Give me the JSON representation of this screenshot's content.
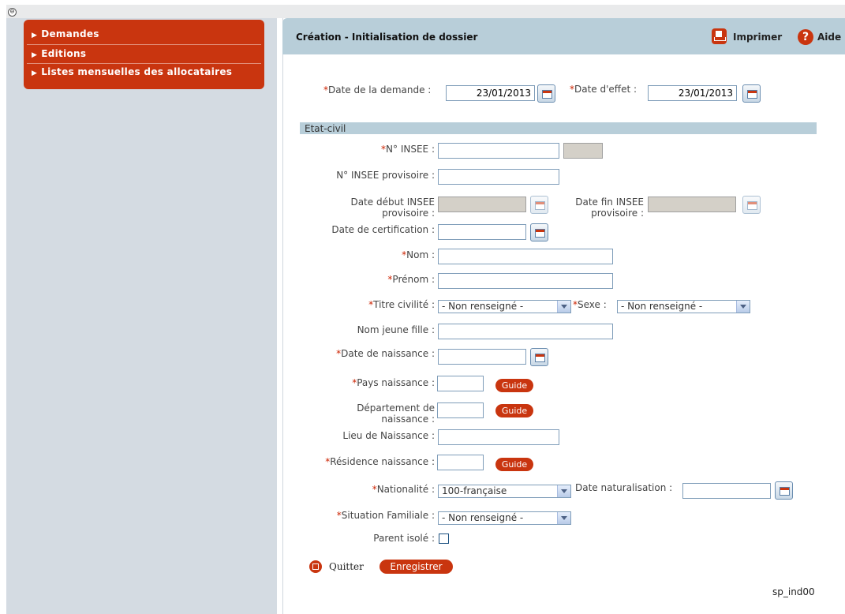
{
  "collapse_icon": "⊖",
  "menu": {
    "items": [
      {
        "label": "Demandes"
      },
      {
        "label": "Editions"
      },
      {
        "label": "Listes mensuelles des allocataires"
      }
    ]
  },
  "header": {
    "title": "Création - Initialisation de dossier",
    "print_label": "Imprimer",
    "help_label": "Aide",
    "help_glyph": "?"
  },
  "required_mark": "*",
  "form": {
    "date_demande": {
      "label": "Date de la demande :",
      "value": "23/01/2013"
    },
    "date_effet": {
      "label": "Date d'effet :",
      "value": "23/01/2013"
    },
    "section_title": "Etat-civil",
    "no_insee": {
      "label": "N° INSEE :",
      "value": ""
    },
    "no_insee_prov": {
      "label": "N° INSEE provisoire :",
      "value": ""
    },
    "date_debut_insee": {
      "label_line1": "Date début INSEE",
      "label_line2": "provisoire :",
      "value": ""
    },
    "date_fin_insee": {
      "label_line1": "Date fin INSEE",
      "label_line2": "provisoire :",
      "value": ""
    },
    "date_certification": {
      "label": "Date de certification :",
      "value": ""
    },
    "nom": {
      "label": "Nom :",
      "value": ""
    },
    "prenom": {
      "label": "Prénom :",
      "value": ""
    },
    "titre_civilite": {
      "label": "Titre civilité :",
      "value": "- Non renseigné -"
    },
    "sexe": {
      "label": "Sexe :",
      "value": "- Non renseigné -"
    },
    "nom_jeune_fille": {
      "label": "Nom jeune fille :",
      "value": ""
    },
    "date_naissance": {
      "label": "Date de naissance :",
      "value": ""
    },
    "pays_naissance": {
      "label": "Pays naissance :",
      "value": "",
      "guide": "Guide"
    },
    "departement_naissance": {
      "label_line1": "Département de",
      "label_line2": "naissance :",
      "value": "",
      "guide": "Guide"
    },
    "lieu_naissance": {
      "label": "Lieu de Naissance :",
      "value": ""
    },
    "residence_naissance": {
      "label": "Résidence naissance :",
      "value": "",
      "guide": "Guide"
    },
    "nationalite": {
      "label": "Nationalité :",
      "value": "100-française"
    },
    "date_naturalisation": {
      "label": "Date naturalisation :",
      "value": ""
    },
    "situation_familiale": {
      "label": "Situation Familiale :",
      "value": "- Non renseigné -"
    },
    "parent_isole": {
      "label": "Parent isolé :",
      "checked": false
    }
  },
  "actions": {
    "quit_label": "Quitter",
    "save_label": "Enregistrer"
  },
  "footer_code": "sp_ind00",
  "colors": {
    "accent": "#c9350f",
    "header_bg": "#b8ced9",
    "sidebar_bg": "#d4dbe2"
  }
}
